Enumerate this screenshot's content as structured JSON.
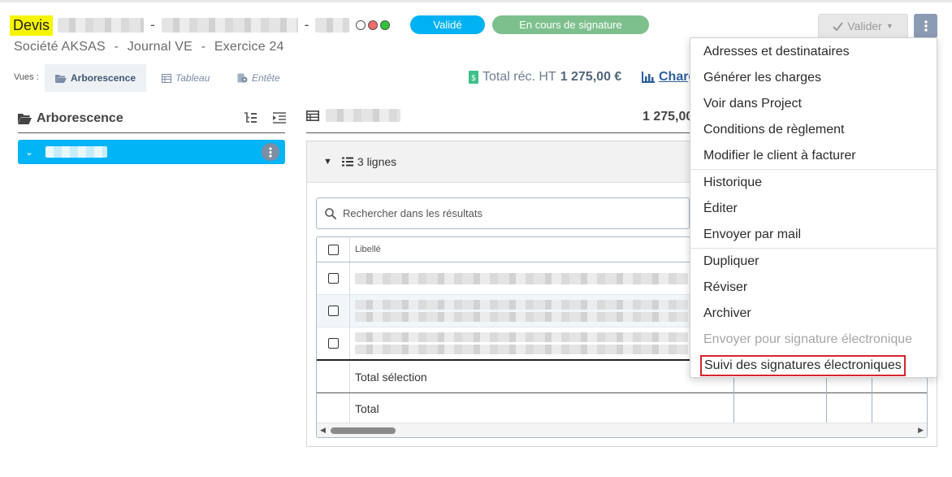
{
  "header": {
    "doc_type": "Devis",
    "sep1": "-",
    "sep2": "-",
    "status_badge": "Validé",
    "signature_badge": "En cours de signature",
    "subtitle": [
      "Société AKSAS",
      "-",
      "Journal VE",
      "-",
      "Exercice 24"
    ],
    "valider_label": "Valider",
    "colors": {
      "badge_blue": "#00b2f2",
      "badge_green": "#7dc08d",
      "dot_gray": "#ffffff",
      "dot_red": "#f26c6c",
      "dot_green": "#2fc437"
    }
  },
  "views": {
    "label": "Vues :",
    "tabs": [
      {
        "label": "Arborescence",
        "icon": "folder-open-icon",
        "active": true
      },
      {
        "label": "Tableau",
        "icon": "table-icon",
        "active": false
      },
      {
        "label": "Entête",
        "icon": "gear-doc-icon",
        "active": false
      }
    ]
  },
  "totals": {
    "total_rec_label": "Total réc. HT",
    "total_rec_value": "1 275,00 €",
    "charts_label": "Charg"
  },
  "tree": {
    "title": "Arborescence",
    "icon": "folder-open-icon"
  },
  "main": {
    "amount": "1 275,00",
    "lines_label": "3 lignes",
    "search_placeholder": "Rechercher dans les résultats",
    "column_libelle": "Libellé",
    "total_selection": "Total sélection",
    "total": "Total"
  },
  "menu": {
    "groups": [
      [
        "Adresses et destinataires",
        "Générer les charges",
        "Voir dans Project",
        "Conditions de règlement",
        "Modifier le client à facturer"
      ],
      [
        "Historique",
        "Éditer",
        "Envoyer par mail"
      ],
      [
        "Dupliquer",
        "Réviser",
        "Archiver",
        "Envoyer pour signature électronique",
        "Suivi des signatures électroniques"
      ]
    ]
  }
}
